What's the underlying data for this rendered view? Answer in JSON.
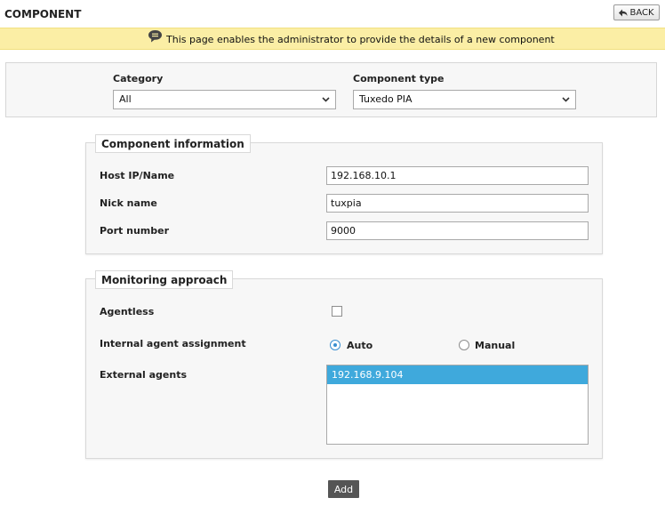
{
  "header": {
    "title": "COMPONENT",
    "back_label": "BACK"
  },
  "banner": {
    "text": "This page enables the administrator to provide the details of a new component"
  },
  "filters": {
    "category_label": "Category",
    "category_value": "All",
    "component_type_label": "Component type",
    "component_type_value": "Tuxedo PIA"
  },
  "component_info": {
    "legend": "Component information",
    "host_label": "Host IP/Name",
    "host_value": "192.168.10.1",
    "nick_label": "Nick name",
    "nick_value": "tuxpia",
    "port_label": "Port number",
    "port_value": "9000"
  },
  "monitoring": {
    "legend": "Monitoring approach",
    "agentless_label": "Agentless",
    "agentless_checked": false,
    "assignment_label": "Internal agent assignment",
    "auto_label": "Auto",
    "manual_label": "Manual",
    "selected_assignment": "Auto",
    "external_label": "External agents",
    "external_agents": [
      "192.168.9.104"
    ]
  },
  "actions": {
    "add_label": "Add"
  },
  "colors": {
    "banner_bg": "#fbeea5",
    "selected_item": "#3fa9dc",
    "add_button": "#555555"
  }
}
